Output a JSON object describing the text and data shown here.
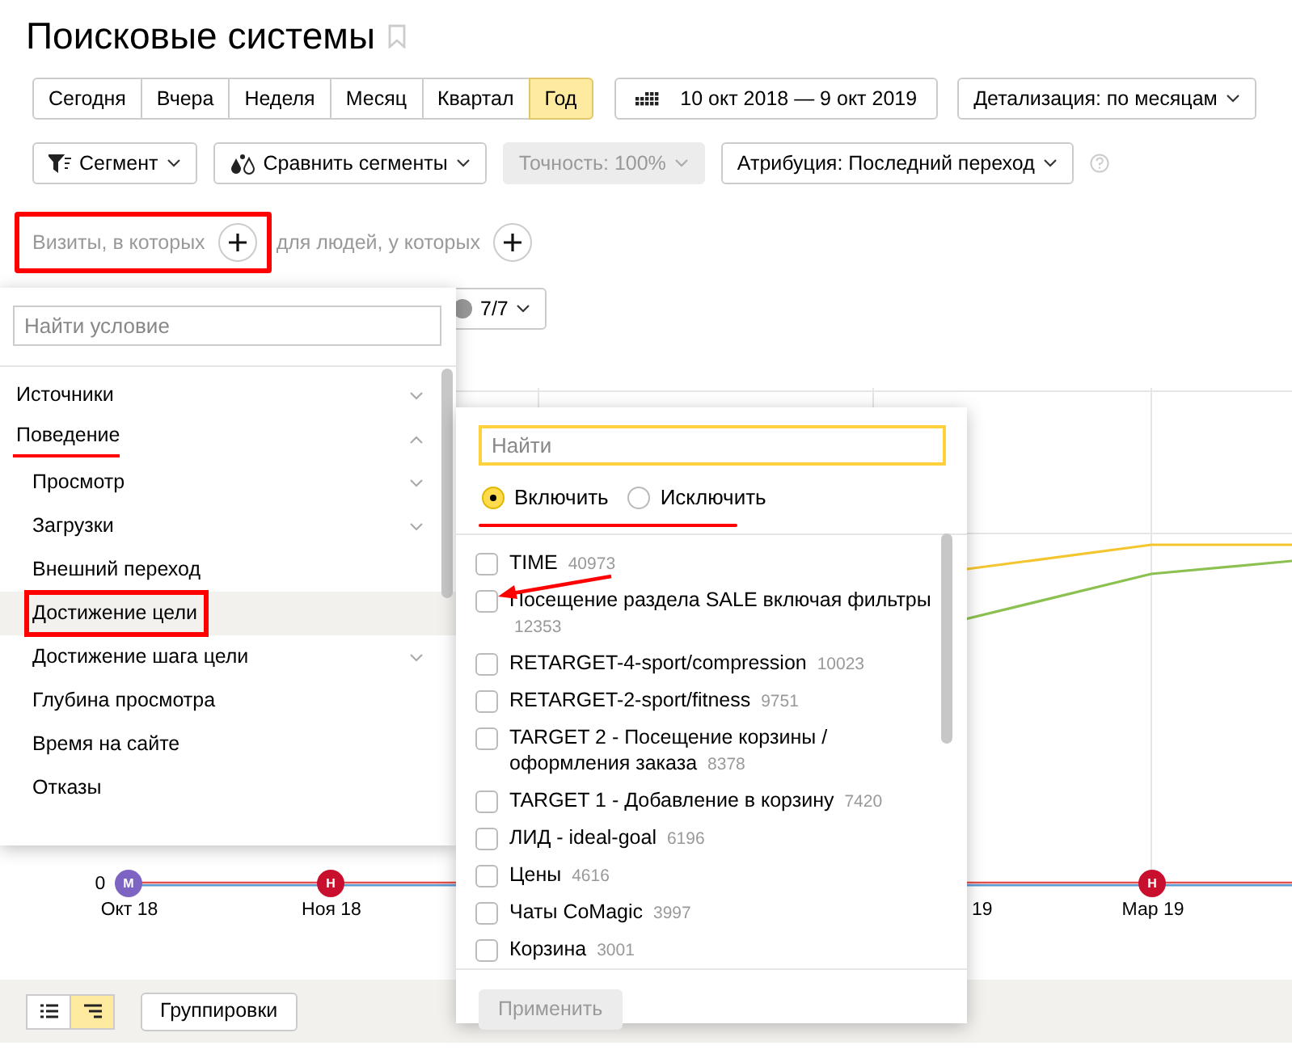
{
  "page": {
    "title": "Поисковые системы"
  },
  "periods": [
    {
      "label": "Сегодня",
      "selected": false
    },
    {
      "label": "Вчера",
      "selected": false
    },
    {
      "label": "Неделя",
      "selected": false
    },
    {
      "label": "Месяц",
      "selected": false
    },
    {
      "label": "Квартал",
      "selected": false
    },
    {
      "label": "Год",
      "selected": true
    }
  ],
  "date_range": "10 окт 2018 — 9 окт 2019",
  "detail": "Детализация: по месяцам",
  "filters": [
    {
      "label": "Сегмент",
      "kind": "segment",
      "disabled": false
    },
    {
      "label": "Сравнить сегменты",
      "kind": "compare",
      "disabled": false
    },
    {
      "label": "Точность: 100%",
      "kind": "plain",
      "disabled": true
    },
    {
      "label": "Атрибуция: Последний переход",
      "kind": "plain",
      "disabled": false
    }
  ],
  "conditions": [
    {
      "label": "Визиты, в которых",
      "framed": true
    },
    {
      "label": "для людей, у которых",
      "framed": false
    }
  ],
  "metrics_button": "7/7",
  "chart": {
    "zero": "0",
    "x_labels": [
      {
        "label": "Окт 18",
        "marker": {
          "letter": "М",
          "color": "#7d64c2"
        }
      },
      {
        "label": "Ноя 18",
        "marker": {
          "letter": "Н",
          "color": "#c8102e"
        }
      },
      {
        "label": "19"
      },
      {
        "label": "Мар 19",
        "marker": {
          "letter": "Н",
          "color": "#c8102e"
        }
      }
    ]
  },
  "condition_menu": {
    "search_placeholder": "Найти условие",
    "items": [
      {
        "label": "Источники",
        "kind": "group",
        "expanded": false,
        "selected": false
      },
      {
        "label": "Поведение",
        "kind": "group",
        "expanded": true,
        "selected": false,
        "underlined": true,
        "children": [
          {
            "label": "Просмотр",
            "kind": "group",
            "expanded": false,
            "selected": false
          },
          {
            "label": "Загрузки",
            "kind": "group",
            "expanded": false,
            "selected": false
          },
          {
            "label": "Внешний переход",
            "kind": "leaf",
            "selected": false
          },
          {
            "label": "Достижение цели",
            "kind": "leaf",
            "selected": true,
            "framed": true
          },
          {
            "label": "Достижение шага цели",
            "kind": "group",
            "expanded": false,
            "selected": false
          },
          {
            "label": "Глубина просмотра",
            "kind": "leaf",
            "selected": false
          },
          {
            "label": "Время на сайте",
            "kind": "leaf",
            "selected": false
          },
          {
            "label": "Отказы",
            "kind": "leaf",
            "selected": false
          }
        ]
      }
    ]
  },
  "goal_panel": {
    "search_placeholder": "Найти",
    "modes": [
      {
        "label": "Включить",
        "selected": true
      },
      {
        "label": "Исключить",
        "selected": false
      }
    ],
    "modes_underlined": true,
    "goals": [
      {
        "name": "TIME",
        "count": "40973",
        "checked": false
      },
      {
        "name": "Посещение раздела SALE включая фильтры",
        "count": "12353",
        "checked": false,
        "arrow": true
      },
      {
        "name": "RETARGET-4-sport/compression",
        "count": "10023",
        "checked": false
      },
      {
        "name": "RETARGET-2-sport/fitness",
        "count": "9751",
        "checked": false
      },
      {
        "name": "TARGET 2 - Посещение корзины / оформления заказа",
        "count": "8378",
        "checked": false
      },
      {
        "name": "TARGET 1 - Добавление в корзину",
        "count": "7420",
        "checked": false
      },
      {
        "name": "ЛИД - ideal-goal",
        "count": "6196",
        "checked": false
      },
      {
        "name": "Цены",
        "count": "4616",
        "checked": false
      },
      {
        "name": "Чаты CoMagic",
        "count": "3997",
        "checked": false
      },
      {
        "name": "Корзина",
        "count": "3001",
        "checked": false
      }
    ],
    "apply": {
      "label": "Применить",
      "disabled": true
    }
  },
  "bottom": {
    "views": [
      {
        "kind": "list",
        "selected": false
      },
      {
        "kind": "tree",
        "selected": true
      }
    ],
    "grouping": "Группировки"
  }
}
